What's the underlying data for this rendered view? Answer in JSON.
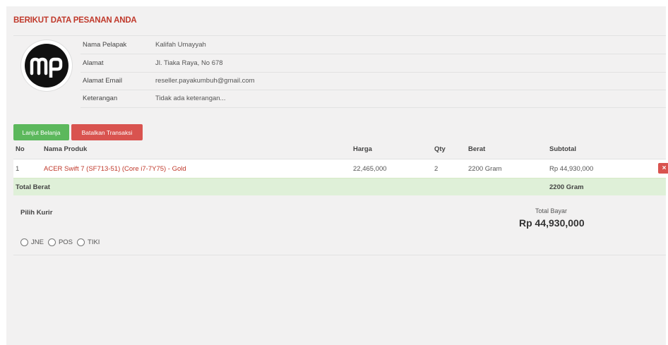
{
  "heading": "BERIKUT DATA PESANAN ANDA",
  "logo_text": "mp",
  "info": [
    {
      "label": "Nama Pelapak",
      "value": "Kalifah Umayyah"
    },
    {
      "label": "Alamat",
      "value": "Jl. Tiaka Raya, No 678"
    },
    {
      "label": "Alamat Email",
      "value": "reseller.payakumbuh@gmail.com"
    },
    {
      "label": "Keterangan",
      "value": "Tidak ada keterangan..."
    }
  ],
  "buttons": {
    "continue": "Lanjut Belanja",
    "cancel": "Batalkan Transaksi"
  },
  "table": {
    "headers": [
      "No",
      "Nama Produk",
      "Harga",
      "Qty",
      "Berat",
      "Subtotal"
    ],
    "rows": [
      {
        "no": "1",
        "product": "ACER Swift 7 (SF713-51) (Core i7-7Y75) - Gold",
        "price": "22,465,000",
        "qty": "2",
        "weight": "2200 Gram",
        "subtotal": "Rp 44,930,000"
      }
    ],
    "delete_icon": "×"
  },
  "total_weight": {
    "label": "Total Berat",
    "value": "2200 Gram"
  },
  "courier": {
    "label": "Pilih Kurir",
    "options": [
      "JNE",
      "POS",
      "TIKI"
    ]
  },
  "payment": {
    "label": "Total Bayar",
    "value": "Rp 44,930,000"
  },
  "colors": {
    "accent": "#c0392b",
    "success": "#5cb85c",
    "danger": "#d9534f",
    "total_row": "#dff0d8"
  }
}
